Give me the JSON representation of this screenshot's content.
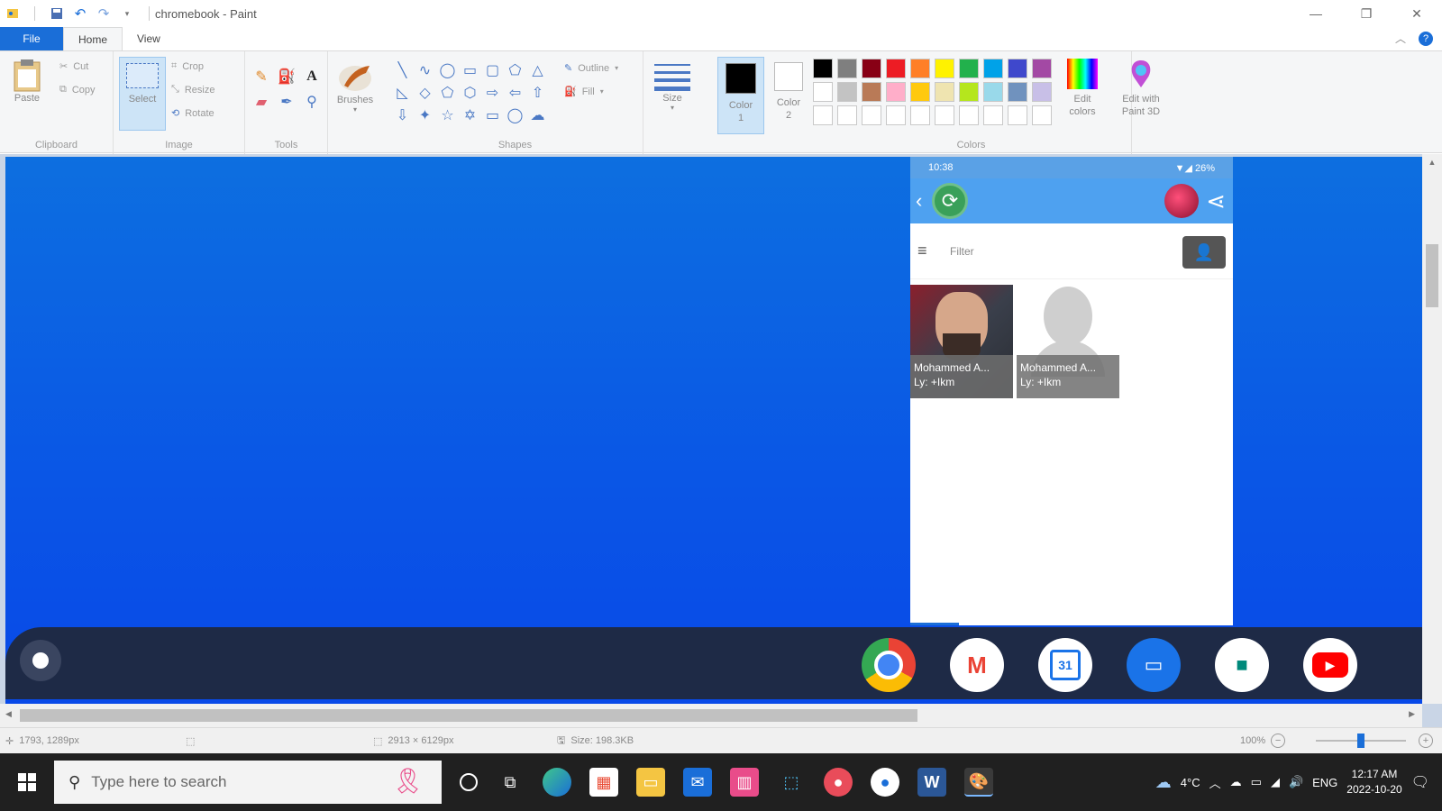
{
  "window": {
    "title": "chromebook - Paint",
    "controls": {
      "minimize": "—",
      "maximize": "❐",
      "close": "✕"
    }
  },
  "tabs": {
    "file": "File",
    "home": "Home",
    "view": "View"
  },
  "ribbon": {
    "clipboard": {
      "label": "Clipboard",
      "paste": "Paste",
      "cut": "Cut",
      "copy": "Copy"
    },
    "image": {
      "label": "Image",
      "select": "Select",
      "crop": "Crop",
      "resize": "Resize",
      "rotate": "Rotate"
    },
    "tools": {
      "label": "Tools"
    },
    "brushes": {
      "label": "Brushes"
    },
    "shapes": {
      "label": "Shapes",
      "outline": "Outline",
      "fill": "Fill"
    },
    "size": {
      "label": "Size"
    },
    "color1": {
      "label": "Color 1",
      "value": "#000000"
    },
    "color2": {
      "label": "Color 2",
      "value": "#ffffff"
    },
    "colors": {
      "label": "Colors",
      "edit": "Edit colors",
      "palette": [
        "#000000",
        "#7f7f7f",
        "#880015",
        "#ed1c24",
        "#ff7f27",
        "#fff200",
        "#22b14c",
        "#00a2e8",
        "#3f48cc",
        "#a349a4",
        "#ffffff",
        "#c3c3c3",
        "#b97a57",
        "#ffaec9",
        "#ffc90e",
        "#efe4b0",
        "#b5e61d",
        "#99d9ea",
        "#7092be",
        "#c8bfe7",
        "#ffffff",
        "#ffffff",
        "#ffffff",
        "#ffffff",
        "#ffffff",
        "#ffffff",
        "#ffffff",
        "#ffffff",
        "#ffffff",
        "#ffffff"
      ]
    },
    "paint3d": {
      "label": "Edit with Paint 3D"
    }
  },
  "canvas_image": {
    "status_time": "10:38",
    "status_right": "▼◢ 26%",
    "filter_label": "Filter",
    "contacts": [
      {
        "name_line1": "Mohammed A...",
        "name_line2": "Ly: +Ikm"
      },
      {
        "name_line1": "Mohammed A...",
        "name_line2": "Ly: +Ikm"
      }
    ],
    "shelf_apps": [
      "Chrome",
      "Gmail",
      "Calendar",
      "Files",
      "Meet",
      "YouTube"
    ],
    "calendar_day": "31"
  },
  "statusbar": {
    "cursor": "1793, 1289px",
    "dimensions": "2913 × 6129px",
    "size": "Size: 198.3KB",
    "zoom": "100%",
    "zoom_level": 0.5
  },
  "taskbar": {
    "search_placeholder": "Type here to search",
    "weather": "4°C",
    "language": "ENG",
    "time": "12:17 AM",
    "date": "2022-10-20"
  }
}
